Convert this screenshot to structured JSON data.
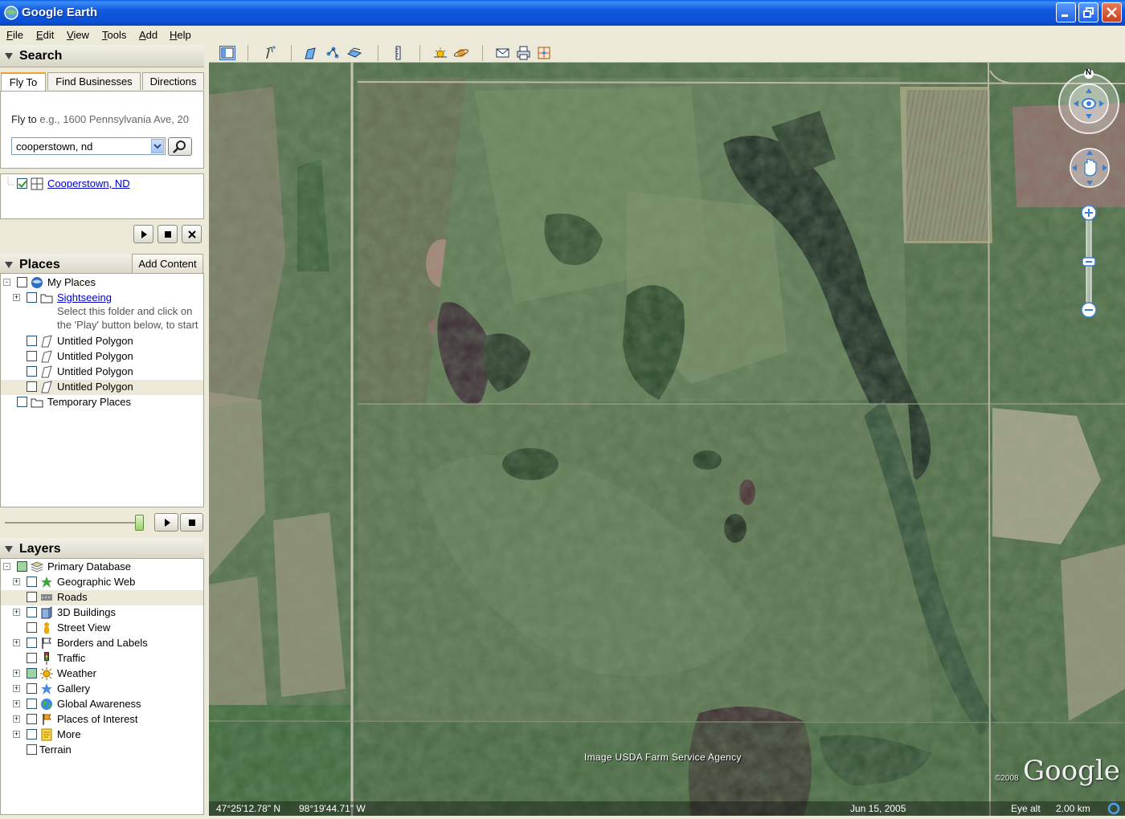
{
  "window": {
    "title": "Google Earth",
    "controls": [
      "minimize-icon",
      "maximize-icon",
      "close-icon"
    ]
  },
  "menu": {
    "items": [
      {
        "label": "File",
        "accel": "F"
      },
      {
        "label": "Edit",
        "accel": "E"
      },
      {
        "label": "View",
        "accel": "V"
      },
      {
        "label": "Tools",
        "accel": "T"
      },
      {
        "label": "Add",
        "accel": "A"
      },
      {
        "label": "Help",
        "accel": "H"
      }
    ]
  },
  "search": {
    "panel_title": "Search",
    "tabs": [
      "Fly To",
      "Find Businesses",
      "Directions"
    ],
    "active_tab": "Fly To",
    "flyto_label": "Fly to",
    "flyto_placeholder": "e.g., 1600 Pennsylvania Ave, 20",
    "query_value": "cooperstown, nd",
    "result": {
      "label": "Cooperstown, ND",
      "checked": true
    }
  },
  "places": {
    "panel_title": "Places",
    "add_content_label": "Add Content",
    "items": [
      {
        "label": "My Places",
        "icon": "globe-icon",
        "level": 0,
        "expander": "-"
      },
      {
        "label": "Sightseeing",
        "icon": "folder-icon",
        "level": 1,
        "expander": "+",
        "link": true,
        "description_line1": "Select this folder and click on",
        "description_line2": "the 'Play' button below, to start"
      },
      {
        "label": "Untitled Polygon",
        "icon": "polygon-icon",
        "level": 1
      },
      {
        "label": "Untitled Polygon",
        "icon": "polygon-icon",
        "level": 1
      },
      {
        "label": "Untitled Polygon",
        "icon": "polygon-icon",
        "level": 1
      },
      {
        "label": "Untitled Polygon",
        "icon": "polygon-icon",
        "level": 1,
        "selected": true
      },
      {
        "label": "Temporary Places",
        "icon": "folder-icon",
        "level": 0
      }
    ]
  },
  "layers": {
    "panel_title": "Layers",
    "items": [
      {
        "label": "Primary Database",
        "icon": "database-icon",
        "expander": "-",
        "state": "partial"
      },
      {
        "label": "Geographic Web",
        "icon": "star-icon",
        "expander": "+"
      },
      {
        "label": "Roads",
        "icon": "road-icon",
        "selected": true
      },
      {
        "label": "3D Buildings",
        "icon": "building-icon",
        "expander": "+"
      },
      {
        "label": "Street View",
        "icon": "pegman-icon"
      },
      {
        "label": "Borders and Labels",
        "icon": "flag-icon",
        "expander": "+"
      },
      {
        "label": "Traffic",
        "icon": "traffic-light-icon"
      },
      {
        "label": "Weather",
        "icon": "sun-icon",
        "expander": "+",
        "state": "partial"
      },
      {
        "label": "Gallery",
        "icon": "star-icon",
        "expander": "+"
      },
      {
        "label": "Global Awareness",
        "icon": "globe-icon",
        "expander": "+"
      },
      {
        "label": "Places of Interest",
        "icon": "flag-icon",
        "expander": "+"
      },
      {
        "label": "More",
        "icon": "note-icon",
        "expander": "+"
      },
      {
        "label": "Terrain",
        "icon": "none",
        "level0": true
      }
    ]
  },
  "toolbar": {
    "buttons": [
      "sidebar-toggle-icon",
      "placemark-icon",
      "polygon-tool-icon",
      "path-tool-icon",
      "image-overlay-icon",
      "ruler-icon",
      "sunlight-icon",
      "planets-icon",
      "email-icon",
      "print-icon",
      "maps-icon"
    ]
  },
  "map": {
    "attribution": "Image USDA Farm Service Agency",
    "logo": "Google",
    "copyright": "©2008",
    "latitude": "47°25'12.78\" N",
    "longitude": "98°19'44.71\" W",
    "imagery_date": "Jun 15, 2005",
    "eye_alt_label": "Eye alt",
    "eye_alt_value": "2.00 km",
    "compass_label": "N"
  },
  "colors": {
    "titlebar": "#0a4fd4",
    "chrome": "#ece9d8",
    "link": "#0000cc",
    "check": "#21a121"
  }
}
